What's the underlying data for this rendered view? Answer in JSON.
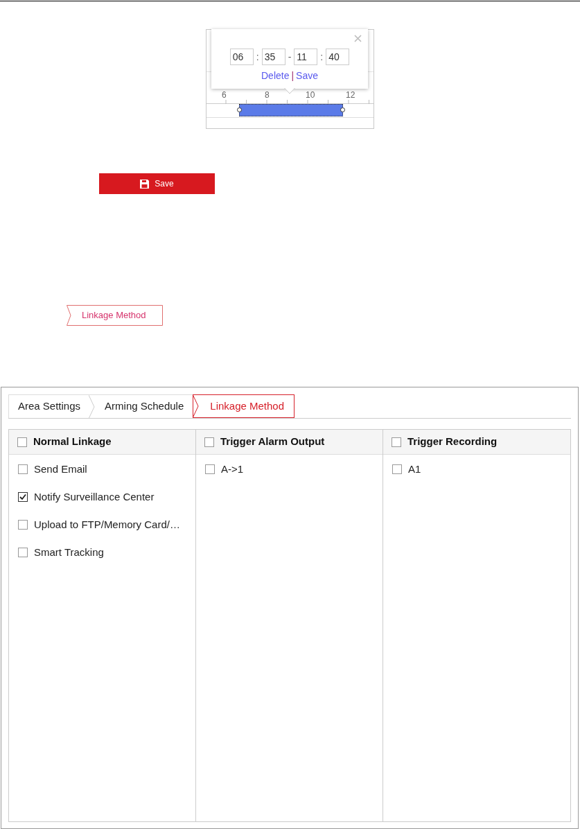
{
  "schedule_editor": {
    "times": [
      "06",
      "35",
      "11",
      "40"
    ],
    "separators": [
      ":",
      "-",
      ":"
    ],
    "actions": [
      {
        "kind": "link",
        "label": "Delete"
      },
      {
        "kind": "divider",
        "label": "|"
      },
      {
        "kind": "link",
        "label": "Save"
      }
    ],
    "ruler_labels": [
      "6",
      "8",
      "10",
      "12"
    ]
  },
  "save_button": {
    "label": "Save"
  },
  "breadcrumb_tab": {
    "label": "Linkage Method"
  },
  "linkage_panel": {
    "tabs": [
      {
        "label": "Area Settings",
        "selected": false
      },
      {
        "label": "Arming Schedule",
        "selected": false
      },
      {
        "label": "Linkage Method",
        "selected": true
      }
    ],
    "columns": [
      {
        "title": "Normal Linkage",
        "checked": false,
        "items": [
          {
            "label": "Send Email",
            "checked": false
          },
          {
            "label": "Notify Surveillance Center",
            "checked": true
          },
          {
            "label": "Upload to FTP/Memory Card/…",
            "checked": false
          },
          {
            "label": "Smart Tracking",
            "checked": false
          }
        ]
      },
      {
        "title": "Trigger Alarm Output",
        "checked": false,
        "items": [
          {
            "label": "A->1",
            "checked": false
          }
        ]
      },
      {
        "title": "Trigger Recording",
        "checked": false,
        "items": [
          {
            "label": "A1",
            "checked": false
          }
        ]
      }
    ]
  }
}
